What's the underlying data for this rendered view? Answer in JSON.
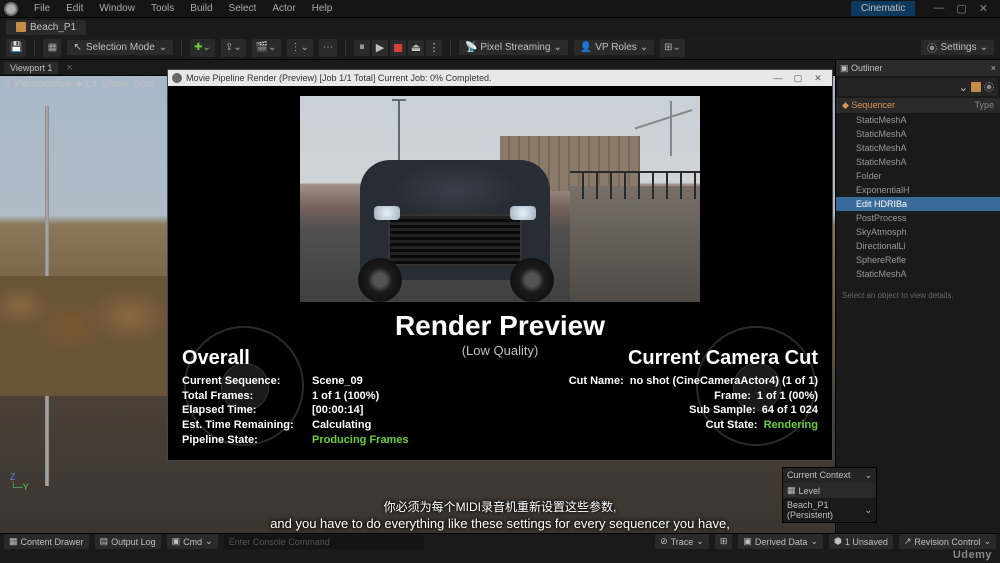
{
  "menubar": {
    "items": [
      "File",
      "Edit",
      "Window",
      "Tools",
      "Build",
      "Select",
      "Actor",
      "Help"
    ],
    "cinematic": "Cinematic"
  },
  "tab": {
    "level_name": "Beach_P1"
  },
  "toolbar": {
    "selection_mode": "Selection Mode",
    "pixel_streaming": "Pixel Streaming",
    "vp_roles": "VP Roles",
    "settings": "Settings"
  },
  "viewport": {
    "tab_name": "Viewport 1",
    "persp": "Perspective",
    "lit": "Lit",
    "show": "Show",
    "scal": "Scal"
  },
  "outliner": {
    "title": "Outliner",
    "col_sequencer": "Sequencer",
    "col_type": "Type",
    "items": [
      "StaticMeshA",
      "StaticMeshA",
      "StaticMeshA",
      "StaticMeshA",
      "Folder",
      "ExponentialH",
      "Edit HDRIBa",
      "PostProcess",
      "SkyAtmosph",
      "DirectionalLi",
      "SphereRefle",
      "StaticMeshA"
    ],
    "selected_index": 6,
    "details_hint": "Select an object to view details."
  },
  "render_dialog": {
    "title": "Movie Pipeline Render (Preview) [Job 1/1 Total] Current Job: 0% Completed.",
    "heading": "Render Preview",
    "subheading": "(Low Quality)",
    "overall": {
      "title": "Overall",
      "lines": [
        {
          "label": "Current Sequence:",
          "value": "Scene_09"
        },
        {
          "label": "Total Frames:",
          "value": "1 of 1 (100%)"
        },
        {
          "label": "Elapsed Time:",
          "value": "[00:00:14]"
        },
        {
          "label": "Est. Time Remaining:",
          "value": "Calculating"
        },
        {
          "label": "Pipeline State:",
          "value": "Producing Frames",
          "green": true
        }
      ]
    },
    "current": {
      "title": "Current Camera Cut",
      "lines": [
        {
          "label": "Cut Name:",
          "value": "no shot (CineCameraActor4) (1 of 1)"
        },
        {
          "label": "Frame:",
          "value": "1 of 1 (00%)"
        },
        {
          "label": "Sub Sample:",
          "value": "64 of 1 024"
        },
        {
          "label": "Cut State:",
          "value": "Rendering",
          "green": true
        }
      ]
    }
  },
  "context_popup": {
    "header": "Current Context",
    "level_label": "Level",
    "selected": "Beach_P1 (Persistent)"
  },
  "subtitles": {
    "cn": "你必须为每个MIDI录音机重新设置这些参数,",
    "en": "and you have to do everything like these settings for every sequencer you have,"
  },
  "bottombar": {
    "content_drawer": "Content Drawer",
    "output_log": "Output Log",
    "cmd": "Cmd",
    "cmd_placeholder": "Enter Console Command",
    "trace": "Trace",
    "derived_data": "Derived Data",
    "unsaved": "1 Unsaved",
    "revision": "Revision Control"
  },
  "watermark": "Udemy"
}
